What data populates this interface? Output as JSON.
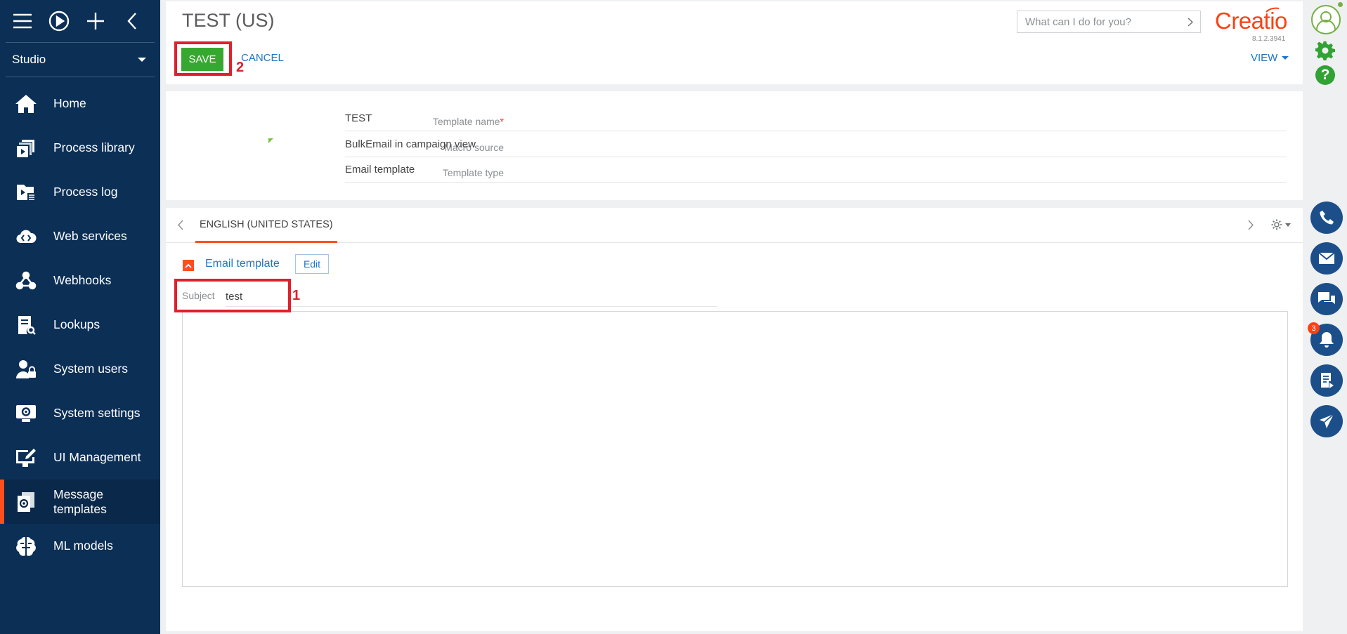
{
  "sidebar": {
    "workplace": "Studio",
    "items": [
      {
        "label": "Home",
        "icon": "home-icon"
      },
      {
        "label": "Process library",
        "icon": "process-library-icon"
      },
      {
        "label": "Process log",
        "icon": "process-log-icon"
      },
      {
        "label": "Web services",
        "icon": "web-services-icon"
      },
      {
        "label": "Webhooks",
        "icon": "webhooks-icon"
      },
      {
        "label": "Lookups",
        "icon": "lookups-icon"
      },
      {
        "label": "System users",
        "icon": "system-users-icon"
      },
      {
        "label": "System settings",
        "icon": "system-settings-icon"
      },
      {
        "label": "UI Management",
        "icon": "ui-management-icon"
      },
      {
        "label_line1": "Message",
        "label_line2": "templates",
        "icon": "message-templates-icon",
        "active": true
      },
      {
        "label": "ML models",
        "icon": "ml-models-icon"
      }
    ]
  },
  "header": {
    "title": "TEST (US)",
    "save_label": "SAVE",
    "cancel_label": "CANCEL",
    "view_label": "VIEW",
    "search_placeholder": "What can I do for you?",
    "logo_text": "Creatio",
    "version": "8.1.2.3941"
  },
  "fields": {
    "template_name_label": "Template name",
    "template_name_required": "*",
    "template_name_value": "TEST",
    "macro_source_label": "Macro source",
    "macro_source_value": "BulkEmail in campaign view",
    "template_type_label": "Template type",
    "template_type_value": "Email template"
  },
  "editor": {
    "tab_label": "ENGLISH (UNITED STATES)",
    "section_label": "Email template",
    "edit_label": "Edit",
    "subject_label": "Subject",
    "subject_value": "test"
  },
  "annotations": {
    "step1": "1",
    "step2": "2"
  },
  "rail": {
    "notification_count": "3"
  },
  "colors": {
    "sidebar_bg": "#0c2f56",
    "accent_orange": "#ff4f1f",
    "save_green": "#36a82f",
    "link_blue": "#1f76c4",
    "annotation_red": "#e0202a"
  }
}
